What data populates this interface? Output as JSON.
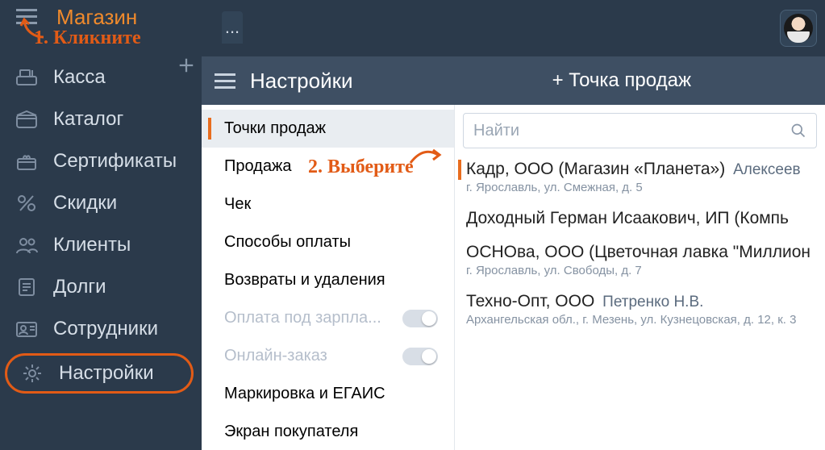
{
  "header": {
    "shop_label": "Магазин",
    "tab_indicator": "..."
  },
  "sidebar": {
    "items": [
      {
        "label": "Касса"
      },
      {
        "label": "Каталог"
      },
      {
        "label": "Сертификаты"
      },
      {
        "label": "Скидки"
      },
      {
        "label": "Клиенты"
      },
      {
        "label": "Долги"
      },
      {
        "label": "Сотрудники"
      },
      {
        "label": "Настройки"
      }
    ]
  },
  "panel": {
    "title": "Настройки",
    "add_button": "+ Точка продаж",
    "settings_menu": [
      {
        "label": "Точки продаж"
      },
      {
        "label": "Продажа"
      },
      {
        "label": "Чек"
      },
      {
        "label": "Способы оплаты"
      },
      {
        "label": "Возвраты и удаления"
      },
      {
        "label": "Оплата под зарпла..."
      },
      {
        "label": "Онлайн-заказ"
      },
      {
        "label": "Маркировка и ЕГАИС"
      },
      {
        "label": "Экран покупателя"
      }
    ],
    "search_placeholder": "Найти",
    "rows": [
      {
        "title": "Кадр, ООО (Магазин «Планета»)",
        "secondary": "Алексеев",
        "sub": "г. Ярославль, ул. Смежная, д. 5"
      },
      {
        "title": "Доходный Герман Исаакович, ИП (Компь",
        "secondary": "",
        "sub": ""
      },
      {
        "title": "ОСНОва, ООО (Цветочная лавка \"Миллион",
        "secondary": "",
        "sub": "г. Ярославль, ул. Свободы, д. 7"
      },
      {
        "title": "Техно-Опт, ООО",
        "secondary": "Петренко Н.В.",
        "sub": "Архангельская обл., г. Мезень, ул. Кузнецовская, д. 12, к. 3"
      }
    ]
  },
  "annotations": {
    "step1": "1. Кликните",
    "step2": "2. Выберите"
  }
}
